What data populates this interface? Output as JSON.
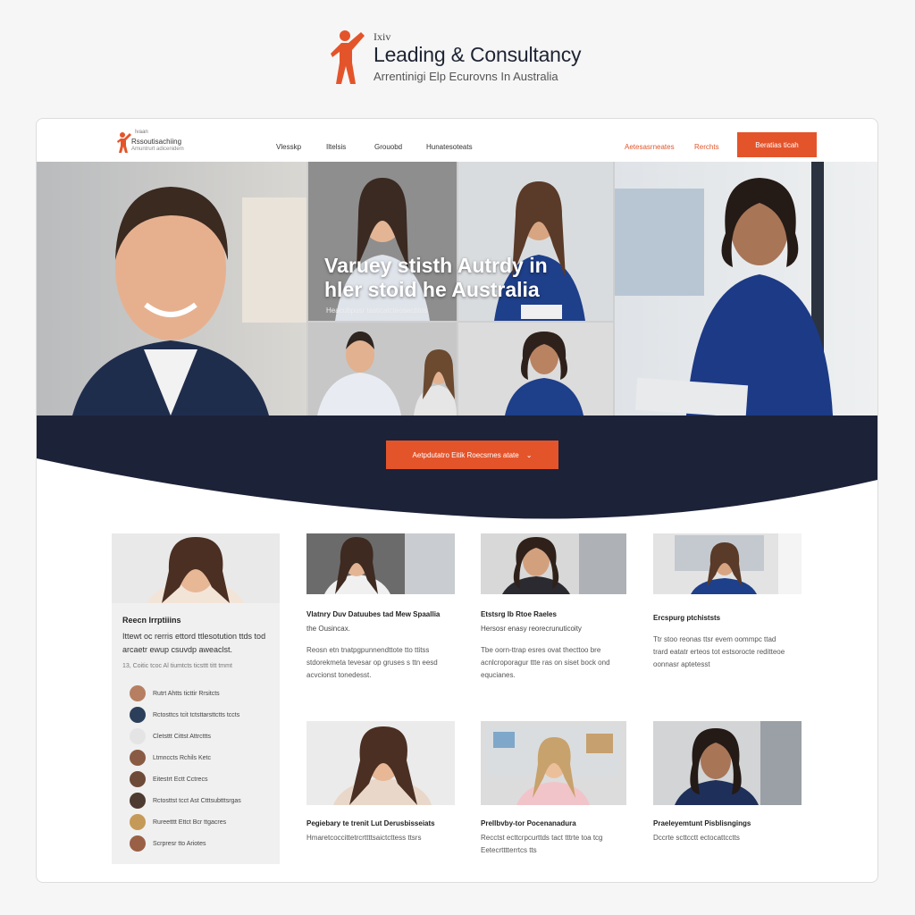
{
  "brand": {
    "small_text": "Ixiv",
    "title": "Leading & Consultancy",
    "tagline": "Arrentinigi Elp Ecurovns In Australia",
    "figure_icon": "person-figure-icon",
    "accent": "#e4542b"
  },
  "nav": {
    "logo_small": "Ivaan",
    "logo_title": "Rssoutisachiing",
    "logo_sub": "Amuntrurt adicenidem",
    "links": [
      "Vlesskp",
      "Iltelsis",
      "Grouobd",
      "Hunatesoteats"
    ],
    "right_links": [
      "Aetesasrneates",
      "Rerchts"
    ],
    "cta": "Beratias  ticah"
  },
  "hero": {
    "headline_line1": "Varuey stisth Autrdy in",
    "headline_line2": "hler stoid he Australia",
    "caption": "Heacubpusr tasticatcteosecbtos"
  },
  "band": {
    "color": "#1c2238",
    "cta": "Aetpdutatro Eitik Roecsrnes atate",
    "cta_icon": "chevron-down-icon"
  },
  "sidebar": {
    "title": "Reecn Irrptiiins",
    "text_line1": "Ittewt oc rerris ettord ttlesotution ttds tod",
    "text_line2": "arcaetr ewup csuvdp aweaclst.",
    "meta": "13, Coitic tcoc Al tiumtcts ticsttt titt tmmt",
    "items": [
      "Rutrt Ahtts ticttir Rrsitcts",
      "Rctosttcs tcit tctsttarsttctts tccts",
      "Cletsttt Cittst Attrcttts",
      "Ltmnccts Rchils Ketc",
      "Eitestrt Ectt Cctrecs",
      "Rctosttst tcct Ast Ctttsubtttsrgas",
      "Rureetttt Ettct Bcr ttgacres",
      "Scrpresr tto Ariotes"
    ]
  },
  "articles": [
    {
      "title": "Vlatnry Duv Datuubes tad Mew Spaallia",
      "sub": "the Ousincax.",
      "text": [
        "Reosn etn tnatpgpunnendttote tto ttitss",
        "stdorekmeta tevesar op gruses s ttn eesd",
        "acvcionst tonedesst."
      ]
    },
    {
      "title": "Etstsrg Ib Rtoe Raeles",
      "sub": "Hersosr enasy reorecrunuticoity",
      "text": [
        "Tbe oorn-ttrap esres ovat thecttoo bre",
        "acnlcroporagur ttte ras on siset bock ond",
        "equcianes."
      ]
    },
    {
      "title": "Ercspurg ptchiststs",
      "sub": "",
      "text": [
        "Ttr stoo reonas ttsr evem oommpc ttad",
        "trard eatatr erteos tot estsorocte reditteoe",
        "oonnasr aptetesst"
      ]
    },
    {
      "title": "Pegiebary te trenit  Lut  Derusbisseiats",
      "sub": "",
      "text": [
        "Hmaretcoccittetrcrttttsaictcttess ttsrs"
      ]
    },
    {
      "title": "Prellbvby-tor Pocenanadura",
      "sub": "",
      "text": [
        "Recctst ecttcrpcurttds tact tttrte toa tcg",
        "Eetecrtttterrtcs tts"
      ]
    },
    {
      "title": "Praeleyemtunt Pisblisngings",
      "sub": "",
      "text": [
        "Dccrte scttcctt ectocattcctts"
      ]
    }
  ]
}
